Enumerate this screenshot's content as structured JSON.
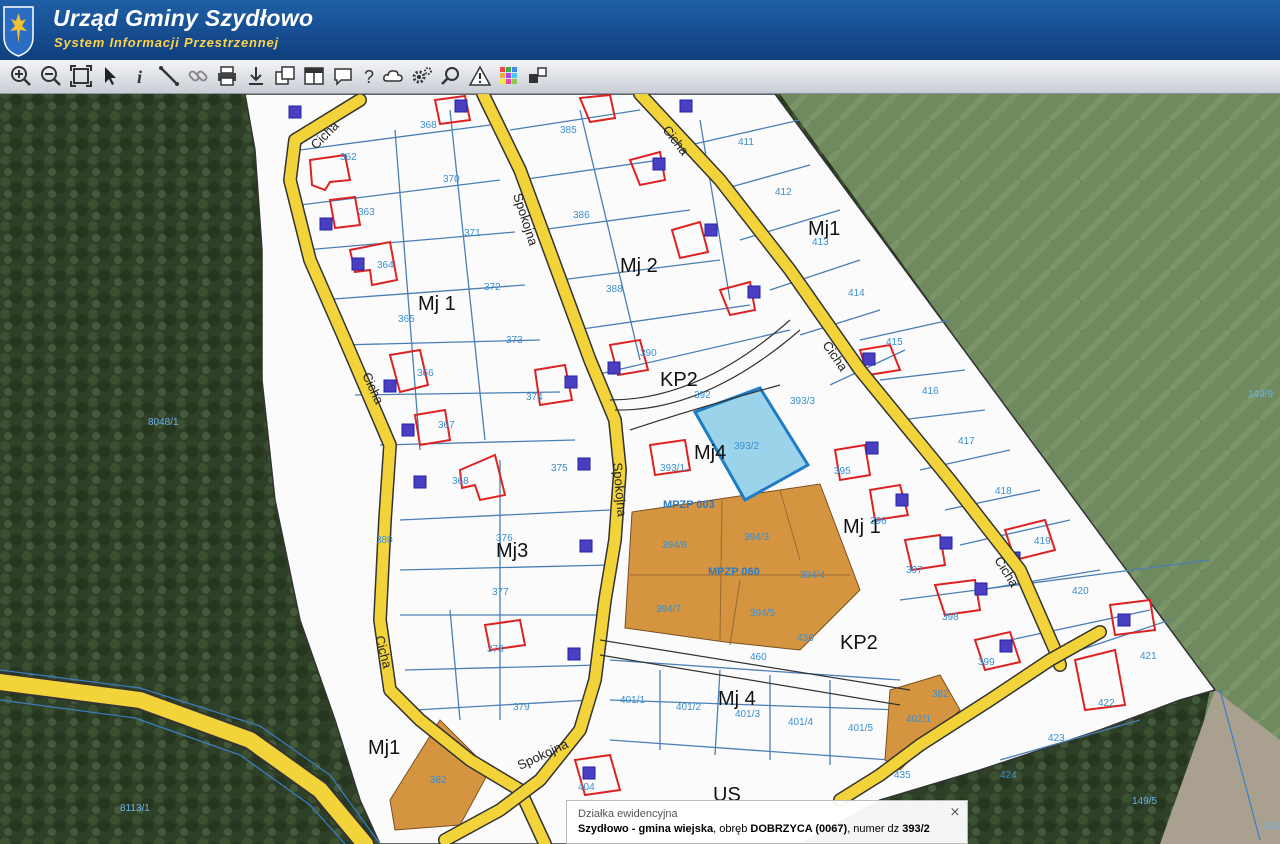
{
  "header": {
    "title": "Urząd Gminy Szydłowo",
    "subtitle": "System Informacji Przestrzennej"
  },
  "toolbar": {
    "tools": [
      "zoom-in-icon",
      "zoom-out-icon",
      "zoom-extent-icon",
      "select-arrow-icon",
      "info-icon",
      "measure-icon",
      "link-icon",
      "print-icon",
      "download-icon",
      "layers-icon",
      "layout-icon",
      "comment-icon",
      "help-icon",
      "cloud-icon",
      "settings-icon",
      "search-icon",
      "warning-icon",
      "color-palette-icon",
      "filter-icon"
    ]
  },
  "map": {
    "zone_labels": [
      "Mj 1",
      "Mj 2",
      "Mj1",
      "KP2",
      "Mj4",
      "Mj 1",
      "Mj3",
      "KP2",
      "Mj 4",
      "Mj1",
      "US"
    ],
    "road_labels": [
      "Cicha",
      "Spokojna",
      "Cicha",
      "Cicha",
      "Cicha",
      "Spokojna",
      "Cicha",
      "Cicha",
      "Spokojna"
    ],
    "plan_labels": [
      "MPZP 003",
      "MPZP 060"
    ],
    "parcel_numbers": [
      "385",
      "411",
      "368",
      "370",
      "386",
      "412",
      "413",
      "371",
      "362",
      "363",
      "364",
      "388",
      "365",
      "372",
      "373",
      "414",
      "390",
      "415",
      "366",
      "374",
      "392",
      "367",
      "393/3",
      "416",
      "393/2",
      "417",
      "375",
      "393/1",
      "395",
      "368",
      "418",
      "394/6",
      "394/3",
      "396",
      "376",
      "394/4",
      "397",
      "377",
      "394/7",
      "394/5",
      "419",
      "398",
      "420",
      "378",
      "436",
      "399",
      "421",
      "460",
      "382",
      "401/1",
      "401/2",
      "401/3",
      "401/4",
      "401/5",
      "402/1",
      "422",
      "379",
      "423",
      "424",
      "382",
      "404",
      "435",
      "380",
      "8048/1",
      "8113/1",
      "149/9",
      "149/5",
      "149/3"
    ],
    "road_parcel_numbers": [
      "8048/1",
      "8113/1",
      "149/9",
      "149/5",
      "149/3"
    ]
  },
  "infobox": {
    "category": "Działka ewidencyjna",
    "text_part1": "Szydłowo - gmina wiejska",
    "text_part2": ", obręb ",
    "text_part3": "DOBRZYCA (0067)",
    "text_part4": ", numer dz ",
    "text_part5": "393/2",
    "close": "⨯"
  },
  "colors": {
    "header": "#1a5599",
    "subtitle": "#ffd24a",
    "road": "#f2d43a",
    "orange": "#d4943c",
    "selection": "#9bd4ea"
  }
}
